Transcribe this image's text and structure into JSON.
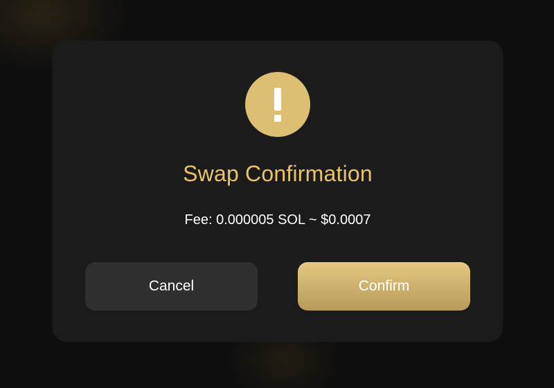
{
  "dialog": {
    "icon": "exclamation-icon",
    "title": "Swap Confirmation",
    "fee_text": "Fee: 0.000005 SOL ~ $0.0007",
    "cancel_label": "Cancel",
    "confirm_label": "Confirm"
  },
  "colors": {
    "accent": "#e8c36a",
    "icon_fill": "#dcbf72",
    "modal_bg": "#1b1b1b",
    "page_bg": "#0e0e0e",
    "cancel_bg": "#2f2f2f",
    "confirm_top": "#e4c981",
    "confirm_bottom": "#b69a5a"
  }
}
